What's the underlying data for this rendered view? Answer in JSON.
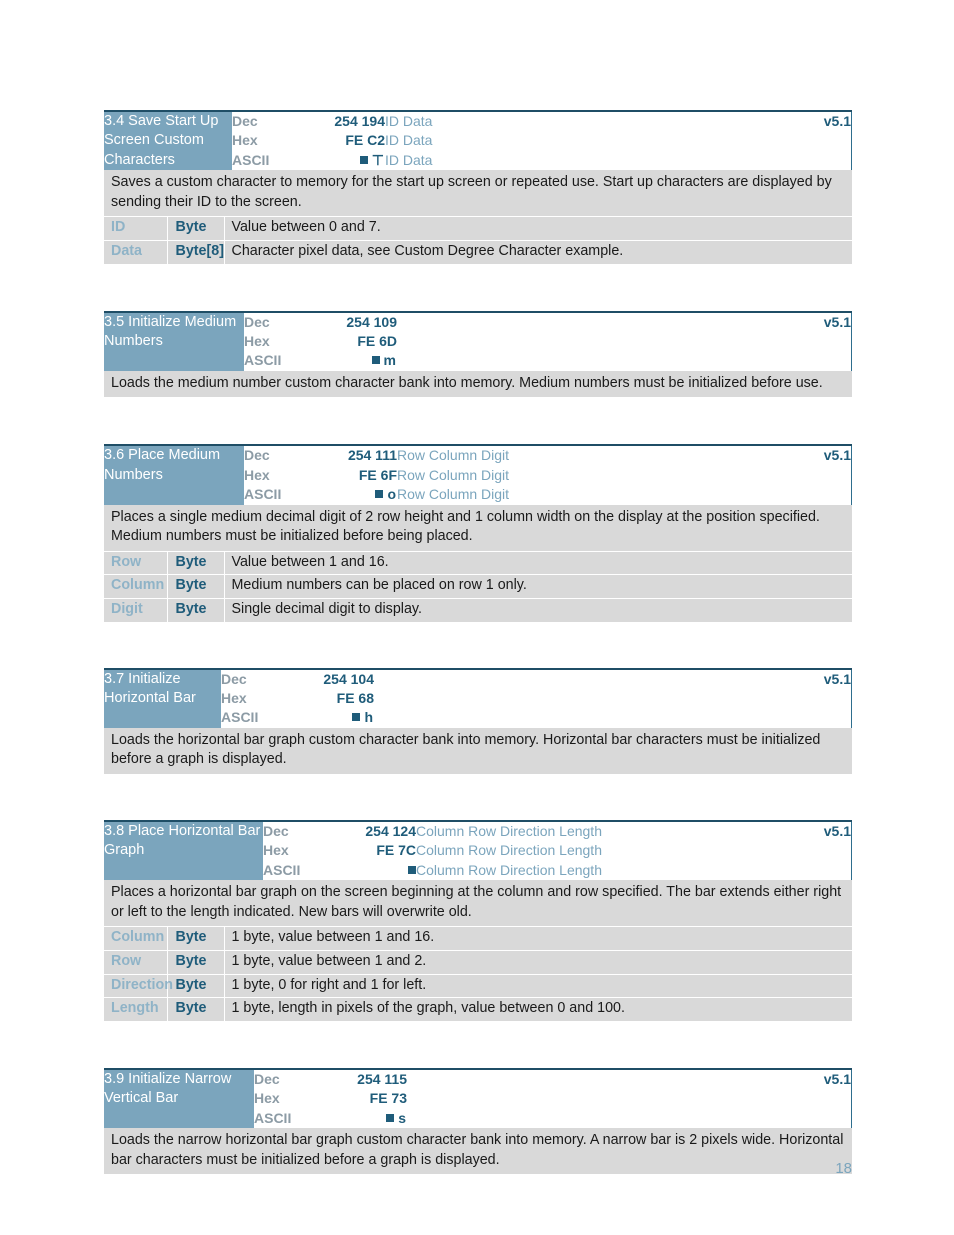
{
  "page": {
    "number": "18"
  },
  "glyphs": {
    "square": "square-glyph",
    "tee": "⊤"
  },
  "commands": [
    {
      "title": "3.4 Save Start Up Screen Custom Characters",
      "version": "v5.1",
      "title_width": 128,
      "rows": [
        {
          "label": "Dec",
          "value": "254 194",
          "params": "ID Data"
        },
        {
          "label": "Hex",
          "value": "FE C2",
          "params": "ID Data"
        },
        {
          "label": "ASCII",
          "value": "ascii",
          "ascii_chars": "⊤",
          "params": "ID Data"
        }
      ],
      "description": "Saves a custom character to memory for the start up screen or repeated use.  Start up characters are displayed by sending their ID to the screen.",
      "parameters": [
        {
          "name": "ID",
          "type": "Byte",
          "desc": "Value between 0 and 7."
        },
        {
          "name": "Data",
          "type": "Byte[8]",
          "desc": "Character pixel data, see Custom Degree Character example."
        }
      ]
    },
    {
      "title": "3.5 Initialize Medium Numbers",
      "version": "v5.1",
      "title_width": 140,
      "rows": [
        {
          "label": "Dec",
          "value": "254 109",
          "params": ""
        },
        {
          "label": "Hex",
          "value": "FE 6D",
          "params": ""
        },
        {
          "label": "ASCII",
          "value": "ascii",
          "ascii_chars": "m",
          "params": ""
        }
      ],
      "description": "Loads the medium number custom character bank into memory.  Medium numbers must be initialized before use.",
      "parameters": []
    },
    {
      "title": "3.6 Place Medium Numbers",
      "version": "v5.1",
      "title_width": 140,
      "rows": [
        {
          "label": "Dec",
          "value": "254 111",
          "params": "Row Column Digit"
        },
        {
          "label": "Hex",
          "value": "FE 6F",
          "params": "Row Column Digit"
        },
        {
          "label": "ASCII",
          "value": "ascii",
          "ascii_chars": "o",
          "params": "Row Column Digit"
        }
      ],
      "description": "Places a single medium decimal digit of 2 row height and 1 column width on the display at the position specified.  Medium numbers must be initialized before being placed.",
      "parameters": [
        {
          "name": "Row",
          "type": "Byte",
          "desc": "Value between 1 and 16."
        },
        {
          "name": "Column",
          "type": "Byte",
          "desc": "Medium numbers can be placed on row 1 only."
        },
        {
          "name": "Digit",
          "type": "Byte",
          "desc": "Single decimal digit to display."
        }
      ]
    },
    {
      "title": "3.7 Initialize Horizontal Bar",
      "version": "v5.1",
      "title_width": 117,
      "rows": [
        {
          "label": "Dec",
          "value": "254 104",
          "params": ""
        },
        {
          "label": "Hex",
          "value": "FE 68",
          "params": ""
        },
        {
          "label": "ASCII",
          "value": "ascii",
          "ascii_chars": "h",
          "params": ""
        }
      ],
      "description": "Loads the horizontal bar graph custom character bank into memory.  Horizontal bar characters must be initialized before a graph is displayed.",
      "parameters": []
    },
    {
      "title": "3.8 Place Horizontal Bar Graph",
      "version": "v5.1",
      "title_width": 159,
      "rows": [
        {
          "label": "Dec",
          "value": "254 124",
          "params": "Column Row Direction Length"
        },
        {
          "label": "Hex",
          "value": "FE 7C",
          "params": "Column Row Direction Length"
        },
        {
          "label": "ASCII",
          "value": "ascii",
          "ascii_chars": "",
          "params": "Column Row Direction Length"
        }
      ],
      "description": "Places a horizontal bar graph on the screen beginning at the column and row specified.  The bar extends either right or left to the length indicated.  New bars will overwrite old.",
      "parameters": [
        {
          "name": "Column",
          "type": "Byte",
          "desc": "1 byte, value between 1 and 16."
        },
        {
          "name": "Row",
          "type": "Byte",
          "desc": "1 byte, value between 1 and 2."
        },
        {
          "name": "Direction",
          "type": "Byte",
          "desc": "1 byte, 0 for right and 1 for left."
        },
        {
          "name": "Length",
          "type": "Byte",
          "desc": "1 byte, length in pixels of the graph, value between 0 and 100."
        }
      ]
    },
    {
      "title": "3.9 Initialize Narrow Vertical Bar",
      "version": "v5.1",
      "title_width": 150,
      "rows": [
        {
          "label": "Dec",
          "value": "254 115",
          "params": ""
        },
        {
          "label": "Hex",
          "value": "FE 73",
          "params": ""
        },
        {
          "label": "ASCII",
          "value": "ascii",
          "ascii_chars": "s",
          "params": ""
        }
      ],
      "description": "Loads the narrow horizontal bar graph custom character bank into memory.  A narrow bar is 2 pixels wide. Horizontal bar characters must be initialized before a graph is displayed.",
      "parameters": []
    }
  ]
}
